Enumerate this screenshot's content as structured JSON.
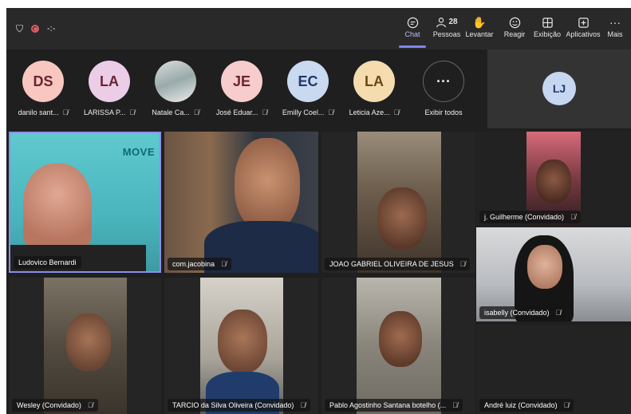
{
  "toolbar": {
    "timer": "-:-",
    "chat_label": "Chat",
    "people_label": "Pessoas",
    "people_count": "28",
    "raise_label": "Levantar",
    "react_label": "Reagir",
    "view_label": "Exibição",
    "apps_label": "Aplicativos",
    "more_label": "Mais"
  },
  "attendees": [
    {
      "initials": "DS",
      "name": "danilo sant...",
      "color": "#f7c7c0"
    },
    {
      "initials": "LA",
      "name": "LARISSA P...",
      "color": "#ebcde8"
    },
    {
      "initials": "",
      "name": "Natale Ca...",
      "color": "#cccccc"
    },
    {
      "initials": "JE",
      "name": "José Eduar...",
      "color": "#f7cccc"
    },
    {
      "initials": "EC",
      "name": "Emilly Coel...",
      "color": "#c9d9f0"
    },
    {
      "initials": "LA",
      "name": "Leticia Aze...",
      "color": "#f4dcae"
    }
  ],
  "show_all": {
    "icon": "···",
    "label": "Exibir todos"
  },
  "self_tile": {
    "initials": "LJ"
  },
  "tiles": [
    {
      "name": "Ludovico Bernardi",
      "bg": "#49b8c0",
      "brand": "MOVE"
    },
    {
      "name": "com.jacobina",
      "bg": "#5a4b3e"
    },
    {
      "name": "JOAO GABRIEL OLIVEIRA DE JESUS",
      "bg": "#7b6f5d"
    },
    {
      "name": "j. Guilherme (Convidado)",
      "bg": "#3a2c2c"
    },
    {
      "name": "isabelly (Convidado)",
      "bg": "#9fa3a8"
    },
    {
      "name": "Wesley (Convidado)",
      "bg": "#5c564a"
    },
    {
      "name": "TARCIO da Silva Oliveira (Convidado)",
      "bg": "#6d6a62"
    },
    {
      "name": "Pablo Agostinho Santana botelho (...",
      "bg": "#6e6a63"
    },
    {
      "name": "André luiz (Convidado)",
      "bg": "#232323"
    }
  ]
}
